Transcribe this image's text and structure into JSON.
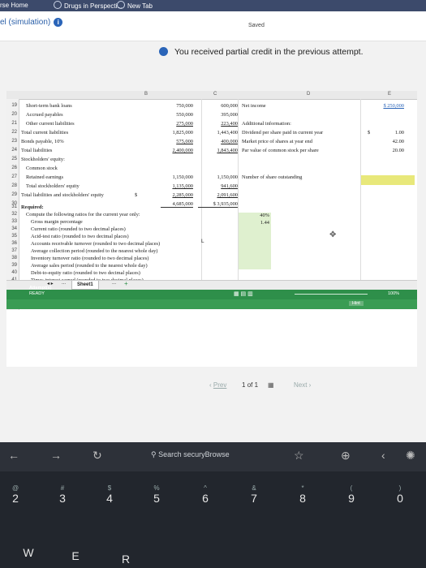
{
  "tabs": [
    {
      "label": "rse Home"
    },
    {
      "label": "Drugs in Perspecti..."
    },
    {
      "label": "New Tab"
    }
  ],
  "title": {
    "text": "el (simulation)",
    "info_icon": "i"
  },
  "status": {
    "saved": "Saved"
  },
  "notice": {
    "text": "You received partial credit in the previous attempt."
  },
  "columns": [
    "B",
    "C",
    "D",
    "E"
  ],
  "rows": [
    {
      "num": "19",
      "label": "Short-term bank loans",
      "c1": "750,000",
      "c2": "600,000"
    },
    {
      "num": "20",
      "label": "Accrued payables",
      "c1": "550,000",
      "c2": "395,000"
    },
    {
      "num": "21",
      "label": "Other current liabilities",
      "c1": "275,000",
      "c2": "223,400"
    },
    {
      "num": "22",
      "label": "Total current liabilities",
      "c1": "1,825,000",
      "c2": "1,443,400"
    },
    {
      "num": "23",
      "label": "Bonds payable, 10%",
      "c1": "575,000",
      "c2": "400,000"
    },
    {
      "num": "24",
      "label": "Total liabilities",
      "c1": "2,400,000",
      "c2": "1,843,400"
    },
    {
      "num": "25",
      "label": "Stockholders' equity:",
      "c1": "",
      "c2": ""
    },
    {
      "num": "26",
      "label": "Common stock",
      "c1": "1,150,000",
      "c2": "1,150,000"
    },
    {
      "num": "27",
      "label": "Retained earnings",
      "c1": "1,135,000",
      "c2": "941,600"
    },
    {
      "num": "28",
      "label": "Total stockholders' equity",
      "c1": "2,285,000",
      "c2": "2,091,600"
    },
    {
      "num": "29",
      "label": "Total liabilities and stockholders' equity",
      "c0": "$",
      "c1": "4,685,000",
      "c2": "$ 3,935,000"
    },
    {
      "num": "30",
      "label": "",
      "c1": "",
      "c2": ""
    }
  ],
  "right": {
    "net_income_label": "Net income",
    "net_income_value": "$ 250,000",
    "additional_label": "Additional information:",
    "items": [
      {
        "label": "Dividend per share paid in current year",
        "cur": "$",
        "value": "1.00"
      },
      {
        "label": "Market price of shares at year end",
        "cur": "",
        "value": "42.00"
      },
      {
        "label": "Par value of common stock per share",
        "cur": "",
        "value": "20.00"
      },
      {
        "label": "Number of share outstanding",
        "cur": "",
        "value": ""
      }
    ]
  },
  "required": {
    "nums": [
      "31",
      "32",
      "33",
      "34",
      "35",
      "36",
      "37",
      "38",
      "39",
      "40",
      "41"
    ],
    "title": "Required:",
    "lines": [
      "Compute the following ratios for the current year only:",
      "Gross margin percentage",
      "Current ratio (rounded to two decimal places)",
      "Acid-test ratio (rounded to two decimal places)",
      "Accounts receivable turnover (rounded to two decimal places)",
      "Average collection period (rounded to the nearest whole day)",
      "Inventory turnover ratio (rounded to two decimal places)",
      "Average sales period (rounded to the nearest whole day)",
      "Debt-to-equity ratio (rounded to two decimal places)",
      "Times interest earned (rounded to two decimal places)"
    ],
    "answers": [
      "40%",
      "1.44"
    ],
    "marker": "L"
  },
  "sheet": {
    "tab": "Sheet1",
    "add": "+",
    "ellipsis": "..."
  },
  "statusbar": {
    "ready": "READY",
    "zoom": "100%",
    "attempts": "Attempt(s)",
    "hint": "Hint"
  },
  "pager": {
    "prev": "Prev",
    "page": "1",
    "of": "of 1",
    "next": "Next"
  },
  "browser": {
    "search": "Search securyBrowse"
  },
  "keys": [
    {
      "top": "@",
      "main": "2"
    },
    {
      "top": "#",
      "main": "3"
    },
    {
      "top": "$",
      "main": "4"
    },
    {
      "top": "%",
      "main": "5"
    },
    {
      "top": "^",
      "main": "6"
    },
    {
      "top": "&",
      "main": "7"
    },
    {
      "top": "*",
      "main": "8"
    },
    {
      "top": "(",
      "main": "9"
    },
    {
      "top": ")",
      "main": "0"
    }
  ],
  "keys_bottom": [
    "W",
    "E",
    "R"
  ]
}
